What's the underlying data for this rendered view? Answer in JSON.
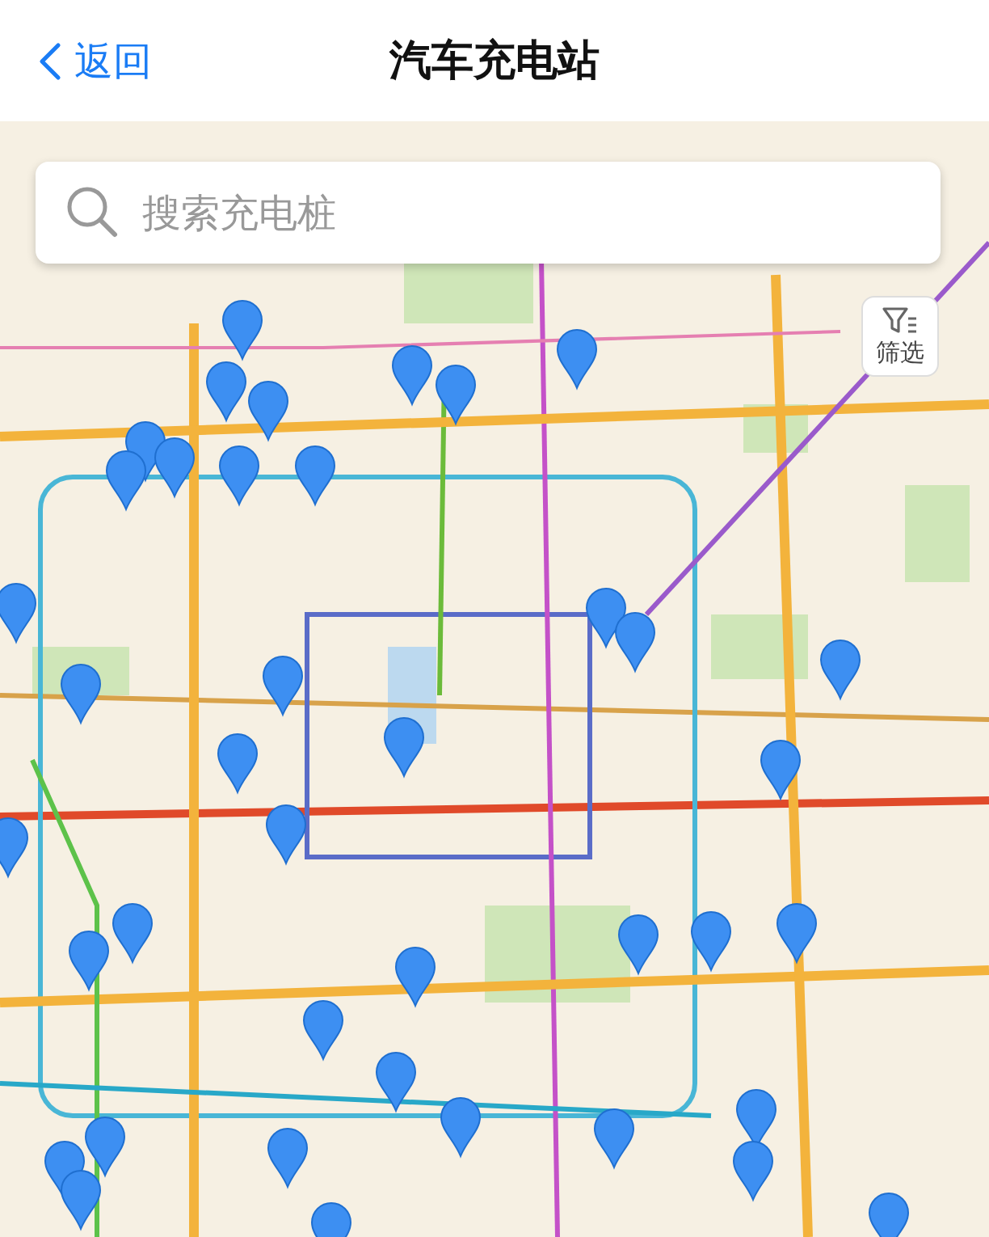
{
  "nav_bar": {
    "back_label": "返回",
    "title": "汽车充电站"
  },
  "search": {
    "placeholder": "搜索充电桩"
  },
  "filter_button": {
    "label": "筛选"
  }
}
